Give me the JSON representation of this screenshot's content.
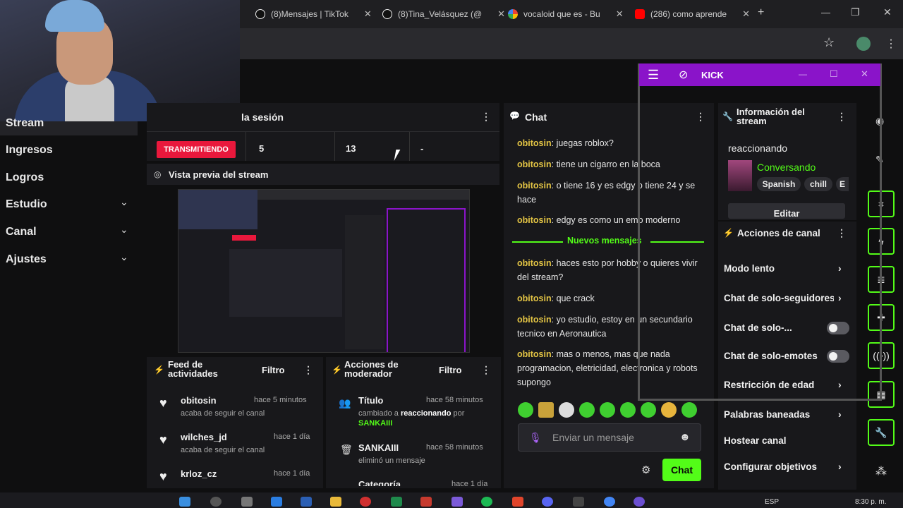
{
  "browser": {
    "tabs": [
      {
        "label": "(8)Mensajes | TikTok",
        "icon": "tiktok-icon"
      },
      {
        "label": "(8)Tina_Velásquez (@",
        "icon": "tiktok-icon"
      },
      {
        "label": "vocaloid que es - Bu",
        "icon": "google-icon"
      },
      {
        "label": "(286) como aprende",
        "icon": "youtube-icon"
      }
    ],
    "new_tab": "+",
    "window_controls": {
      "min": "—",
      "max": "❐",
      "close": "✕"
    },
    "star": "☆"
  },
  "sidebar": {
    "items": [
      {
        "label": "Stream",
        "chevron": false
      },
      {
        "label": "Ingresos",
        "chevron": false
      },
      {
        "label": "Logros",
        "chevron": false
      },
      {
        "label": "Estudio",
        "chevron": true
      },
      {
        "label": "Canal",
        "chevron": true
      },
      {
        "label": "Ajustes",
        "chevron": true
      }
    ],
    "chevron_glyph": "⌄"
  },
  "session": {
    "title": "la sesión",
    "status": "TRANSMITIENDO",
    "stats": [
      "5",
      "13",
      "-"
    ]
  },
  "preview": {
    "title": "Vista previa del stream"
  },
  "feed": {
    "title_line1": "Feed de",
    "title_line2": "actividades",
    "filter": "Filtro",
    "items": [
      {
        "user": "obitosin",
        "time": "hace 5 minutos",
        "action": "acaba de seguir el canal"
      },
      {
        "user": "wilches_jd",
        "time": "hace 1 día",
        "action": "acaba de seguir el canal"
      },
      {
        "user": "krloz_cz",
        "time": "hace 1 día",
        "action": ""
      }
    ]
  },
  "mod": {
    "title_line1": "Acciones de",
    "title_line2": "moderador",
    "filter": "Filtro",
    "items": [
      {
        "title": "Título",
        "time": "hace 58 minutos",
        "line1_a": "cambiado a ",
        "line1_b": "reaccionando",
        "line1_c": " por",
        "line2": "SANKAIII"
      },
      {
        "title": "SANKAIII",
        "time": "hace 58 minutos",
        "line1_a": "eliminó un mensaje",
        "line1_b": "",
        "line1_c": "",
        "line2": ""
      },
      {
        "title": "Categoría",
        "time": "hace 1 día",
        "line1_a": "",
        "line1_b": "",
        "line1_c": "",
        "line2": ""
      }
    ]
  },
  "chat": {
    "title": "Chat",
    "messages_before": [
      {
        "user": "obitosin",
        "text": "juegas roblox?"
      },
      {
        "user": "obitosin",
        "text": "tiene un cigarro en la boca"
      },
      {
        "user": "obitosin",
        "text": "o tiene 16 y es edgy o tiene 24 y se hace"
      },
      {
        "user": "obitosin",
        "text": "edgy es como un emo moderno"
      }
    ],
    "new_messages": "Nuevos mensajes",
    "messages_after": [
      {
        "user": "obitosin",
        "text": "haces esto por hobby o quieres vivir del stream?"
      },
      {
        "user": "obitosin",
        "text": "que crack"
      },
      {
        "user": "obitosin",
        "text": "yo estudio, estoy en un secundario tecnico en Aeronautica"
      },
      {
        "user": "obitosin",
        "text": "mas o menos, mas que nada programacion, eletricidad, electronica y robots supongo"
      }
    ],
    "input_placeholder": "Enviar un mensaje",
    "send_label": "Chat"
  },
  "info": {
    "title_line1": "Información del",
    "title_line2": "stream",
    "stream_title": "reaccionando",
    "category": "Conversando",
    "tags": [
      "Spanish",
      "chill",
      "E"
    ],
    "edit_label": "Editar"
  },
  "actions": {
    "title": "Acciones de canal",
    "items": [
      {
        "label": "Modo lento",
        "control": "chevron"
      },
      {
        "label": "Chat de solo-seguidores",
        "control": "chevron"
      },
      {
        "label": "Chat de solo-...",
        "control": "toggle"
      },
      {
        "label": "Chat de solo-emotes",
        "control": "toggle"
      },
      {
        "label": "Restricción de edad",
        "control": "chevron"
      },
      {
        "label": "Palabras baneadas",
        "control": "chevron"
      },
      {
        "label": "Hostear canal",
        "control": "none"
      },
      {
        "label": "Configurar objetivos",
        "control": "chevron"
      }
    ]
  },
  "kick_window": {
    "title": "KICK"
  },
  "taskbar": {
    "lang": "ESP",
    "time": "8:30 p. m."
  },
  "colors": {
    "accent": "#53fc18",
    "live": "#e9183c",
    "kick_bar": "#8a14c9",
    "username": "#e3c444"
  }
}
